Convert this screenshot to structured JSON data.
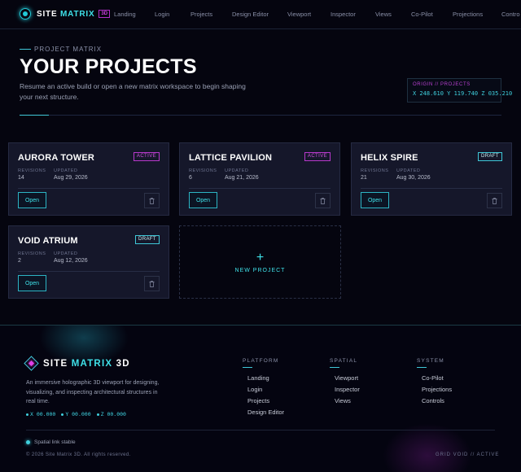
{
  "nav": {
    "brand_prefix": "SITE",
    "brand_accent": "MATRIX",
    "brand_badge": "3D",
    "links": [
      "Landing",
      "Login",
      "Projects",
      "Design Editor",
      "Viewport",
      "Inspector",
      "Views",
      "Co-Pilot",
      "Projections",
      "Contro"
    ]
  },
  "hero": {
    "eyebrow": "PROJECT MATRIX",
    "title": "YOUR PROJECTS",
    "subtitle": "Resume an active build or open a new matrix workspace to begin shaping your next structure.",
    "coords_title": "ORIGIN // PROJECTS",
    "coords": "X 248.610  Y 119.740  Z 035.210"
  },
  "cards": [
    {
      "title": "AURORA TOWER",
      "status": "ACTIVE",
      "revisions_label": "REVISIONS",
      "revisions": "14",
      "updated_label": "UPDATED",
      "updated": "Aug 29, 2026",
      "open_label": "Open"
    },
    {
      "title": "LATTICE PAVILION",
      "status": "ACTIVE",
      "revisions_label": "REVISIONS",
      "revisions": "6",
      "updated_label": "UPDATED",
      "updated": "Aug 21, 2026",
      "open_label": "Open"
    },
    {
      "title": "HELIX SPIRE",
      "status": "DRAFT",
      "revisions_label": "REVISIONS",
      "revisions": "21",
      "updated_label": "UPDATED",
      "updated": "Aug 30, 2026",
      "open_label": "Open"
    },
    {
      "title": "VOID ATRIUM",
      "status": "DRAFT",
      "revisions_label": "REVISIONS",
      "revisions": "2",
      "updated_label": "UPDATED",
      "updated": "Aug 12, 2026",
      "open_label": "Open"
    }
  ],
  "new_project": {
    "plus": "+",
    "label": "NEW PROJECT"
  },
  "footer": {
    "brand_prefix": "SITE",
    "brand_accent": "MATRIX",
    "brand_suffix": "3D",
    "description": "An immersive holographic 3D viewport for designing, visualizing, and inspecting architectural structures in real time.",
    "coords": [
      "X 00.000",
      "Y 00.000",
      "Z 00.000"
    ],
    "columns": [
      {
        "title": "PLATFORM",
        "links": [
          "Landing",
          "Login",
          "Projects",
          "Design Editor"
        ]
      },
      {
        "title": "SPATIAL",
        "links": [
          "Viewport",
          "Inspector",
          "Views"
        ]
      },
      {
        "title": "SYSTEM",
        "links": [
          "Co-Pilot",
          "Projections",
          "Controls"
        ]
      }
    ],
    "status": "Spatial link stable",
    "copyright": "© 2026 Site Matrix 3D. All rights reserved.",
    "grid_status": "GRID VOID // ACTIVE"
  },
  "icons": {
    "brand": "orb-icon",
    "footer_brand": "diamond-icon",
    "trash": "trash-icon"
  },
  "colors": {
    "background": "#05050f",
    "cyan": "#3fe0e8",
    "magenta": "#d050e0",
    "card": "#15172a"
  }
}
